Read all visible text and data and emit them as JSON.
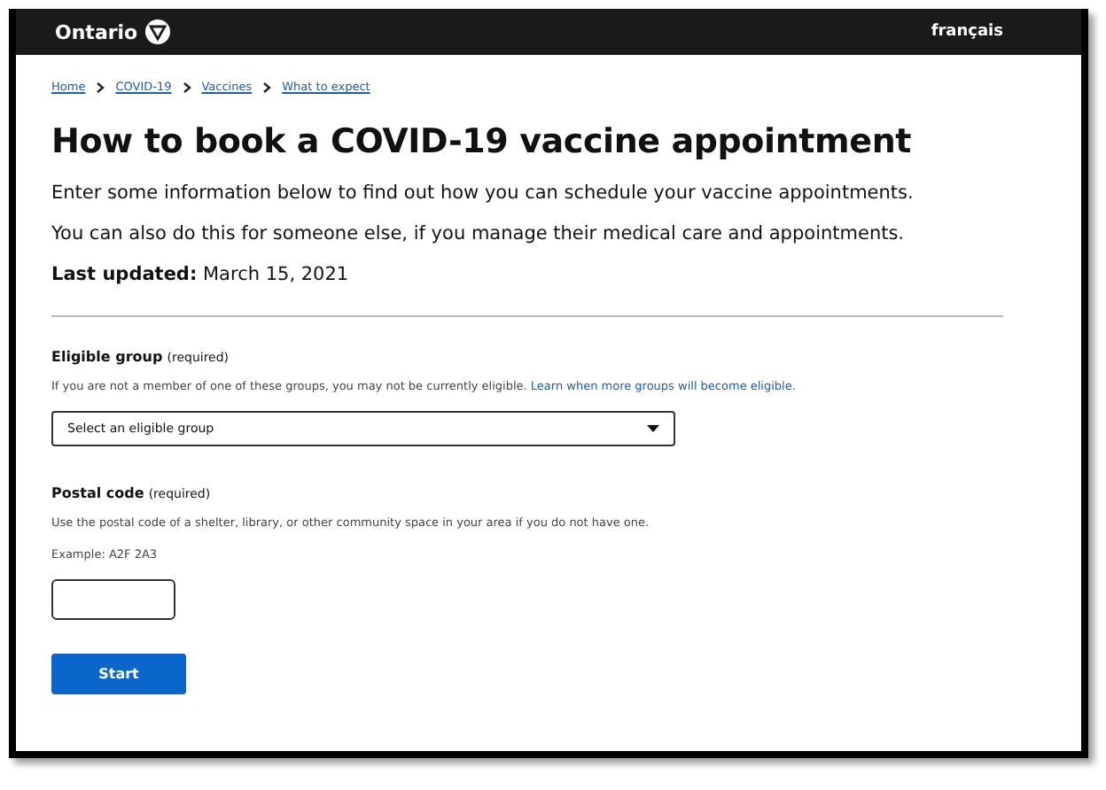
{
  "header": {
    "logo": "Ontario",
    "language_link": "français"
  },
  "breadcrumbs": [
    "Home",
    "COVID-19",
    "Vaccines",
    "What to expect"
  ],
  "title": "How to book a COVID-19 vaccine appointment",
  "intro": [
    "Enter some information below to find out how you can schedule your vaccine appointments.",
    "You can also do this for someone else, if you manage their medical care and appointments."
  ],
  "last_updated": {
    "label": "Last updated:",
    "date": "March 15, 2021"
  },
  "eligible_group": {
    "label": "Eligible group",
    "required": "(required)",
    "hint": "If you are not a member of one of these groups, you may not be currently eligible.",
    "link": "Learn when more groups will become eligible.",
    "placeholder": "Select an eligible group"
  },
  "postal_code": {
    "label": "Postal code",
    "required": "(required)",
    "hint": "Use the postal code of a shelter, library, or other community space in your area if you do not have one.",
    "example": "Example: A2F 2A3"
  },
  "button": "Start"
}
